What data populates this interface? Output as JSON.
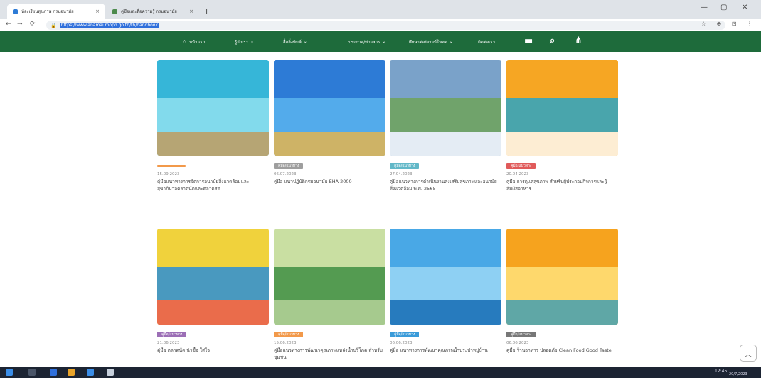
{
  "browser": {
    "tabs": [
      {
        "label": "ห้องเรียนสุขภาพ กรมอนามัย",
        "close": "×"
      },
      {
        "label": "คู่มือและสื่อความรู้ กรมอนามัย",
        "close": "×"
      }
    ],
    "new_tab": "+",
    "window_controls": [
      "—",
      "▢",
      "✕"
    ],
    "nav": {
      "back": "←",
      "forward": "→",
      "reload": "⟳"
    },
    "url": "https://www.anamai.moph.go.th/th/handbook",
    "omni_icons": "☆ ⊕ ⊡ ⋮"
  },
  "site_nav": {
    "home": "หน้าแรก",
    "items": [
      "รู้จักเรา",
      "สื่อสิ่งพิมพ์",
      "ประกาศ/ข่าวสาร",
      "ศึกษาต่อ/ดาวน์โหลด",
      "ติดต่อเรา"
    ],
    "icons": [
      "home-icon",
      "menu-icon",
      "search-icon",
      "sitemap-icon"
    ]
  },
  "cards": [
    {
      "badge": "",
      "badge_color": "#f2994a",
      "date": "15.09.2023",
      "title": "คู่มือแนวทางการจัดการอนามัยสิ่งแวดล้อมและสุขาภิบาลตลาดนัดและตลาดสด",
      "colors": [
        "#36b6d8",
        "#8fe0f0",
        "#d7a15b"
      ]
    },
    {
      "badge": "คู่มือ/แนวทาง",
      "badge_color": "#9e9e9e",
      "date": "06.07.2023",
      "title": "คู่มือ แนวปฏิบัติกรมอนามัย EHA 2000",
      "colors": [
        "#2d7bd6",
        "#5bb4ef",
        "#f6c24a"
      ]
    },
    {
      "badge": "คู่มือ/แนวทาง",
      "badge_color": "#62b8c8",
      "date": "27.04.2023",
      "title": "คู่มือแนวทางการดำเนินงานส่งเสริมสุขภาพและอนามัยสิ่งแวดล้อม พ.ศ. 2565",
      "colors": [
        "#7aa2c9",
        "#6fa35a",
        "#ffffff"
      ]
    },
    {
      "badge": "คู่มือ/แนวทาง",
      "badge_color": "#e05a5a",
      "date": "20.04.2023",
      "title": "คู่มือ การดูแลสุขภาพ สำหรับผู้ประกอบกิจการและผู้สัมผัสอาหาร",
      "colors": [
        "#f6a623",
        "#2aa5c4",
        "#ffffff"
      ]
    },
    {
      "badge": "คู่มือ/แนวทาง",
      "badge_color": "#9c6fb6",
      "date": "21.06.2023",
      "title": "คู่มือ ตลาดนัด น่าซื้อ ใส่ใจ",
      "colors": [
        "#f0d23c",
        "#2c8fd6",
        "#e8524f"
      ]
    },
    {
      "badge": "คู่มือ/แนวทาง",
      "badge_color": "#f2994a",
      "date": "15.06.2023",
      "title": "คู่มือแนวทางการพัฒนาคุณภาพแหล่งน้ำบริโภค สำหรับชุมชน",
      "colors": [
        "#c9dfa2",
        "#3f8f43",
        "#9dc48a"
      ]
    },
    {
      "badge": "คู่มือ/แนวทาง",
      "badge_color": "#3a9bd9",
      "date": "06.06.2023",
      "title": "คู่มือ แนวทางการพัฒนาคุณภาพน้ำประปาหมู่บ้าน",
      "colors": [
        "#49a8e6",
        "#9ad7f5",
        "#1f6fb4"
      ]
    },
    {
      "badge": "คู่มือ/แนวทาง",
      "badge_color": "#777777",
      "date": "06.06.2023",
      "title": "คู่มือ ร้านอาหาร ปลอดภัย Clean Food Good Taste",
      "colors": [
        "#f6a31e",
        "#ffe27a",
        "#3aa7c8"
      ]
    }
  ],
  "scroll_top": "︿",
  "taskbar": {
    "time": "12:45",
    "date": "20/7/2023"
  }
}
